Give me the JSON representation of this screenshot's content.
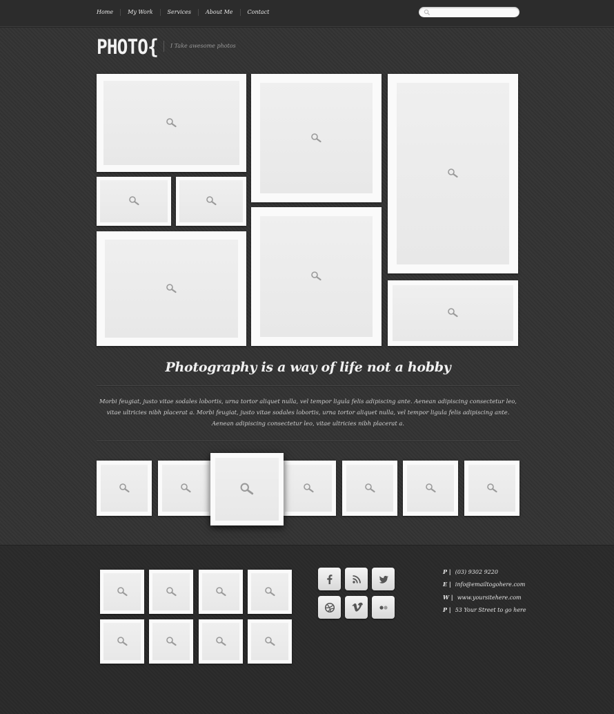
{
  "nav": {
    "items": [
      {
        "label": "Home"
      },
      {
        "label": "My Work"
      },
      {
        "label": "Services"
      },
      {
        "label": "About Me"
      },
      {
        "label": "Contact"
      }
    ]
  },
  "search": {
    "placeholder": ""
  },
  "logo": {
    "text": "PHOTO{",
    "tagline": "I Take awesome photos"
  },
  "gallery": {
    "thumbnail_icon": "zoom-icon"
  },
  "headline": "Photography is a way of life not a hobby",
  "intro_text": "Morbi feugiat, justo vitae sodales lobortis, urna tortor aliquet nulla, vel tempor ligula felis adipiscing ante. Aenean adipiscing consectetur leo, vitae ultricies nibh placerat a. Morbi feugiat, justo vitae sodales lobortis, urna tortor aliquet nulla, vel tempor ligula felis adipiscing ante. Aenean adipiscing consectetur leo, vitae ultricies nibh placerat a.",
  "carousel": {
    "selected_index": 2
  },
  "social": [
    {
      "icon": "facebook-icon"
    },
    {
      "icon": "rss-icon"
    },
    {
      "icon": "twitter-icon"
    },
    {
      "icon": "dribbble-icon"
    },
    {
      "icon": "vimeo-icon"
    },
    {
      "icon": "flickr-icon"
    }
  ],
  "contact": [
    {
      "key": "P |",
      "value": "(03) 9302 9220"
    },
    {
      "key": "E |",
      "value": "info@emailtogohere.com"
    },
    {
      "key": "W |",
      "value": "www.yoursitehere.com"
    },
    {
      "key": "P |",
      "value": "53 Your Street to go here"
    }
  ],
  "colors": {
    "background": "#333333",
    "footer": "#2a2a2a",
    "frame": "#fafafa",
    "photo_placeholder": "#ececec"
  }
}
